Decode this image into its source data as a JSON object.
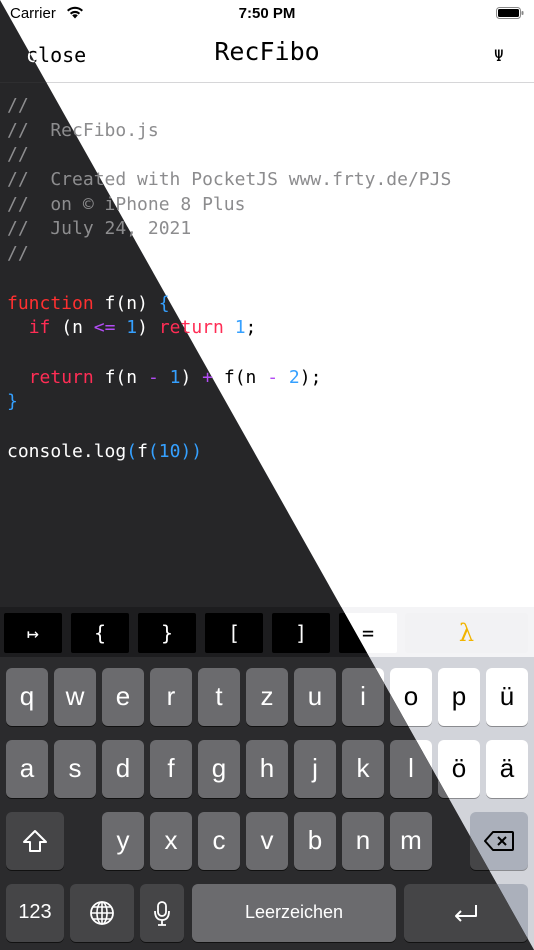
{
  "status": {
    "carrier": "Carrier",
    "time": "7:50 PM"
  },
  "nav": {
    "close_label": "close",
    "title": "RecFibo",
    "menu_symbol": "Ψ"
  },
  "code": {
    "c1": "//",
    "c2": "//  RecFibo.js",
    "c3": "//",
    "c4": "//  Created with PocketJS www.frty.de/PJS",
    "c5": "//  on © iPhone 8 Plus",
    "c6": "//  July 24, 2021",
    "c7": "//",
    "function_kw": "function",
    "fn_name": "f",
    "param": "n",
    "if_kw": "if",
    "lte": "<=",
    "one": "1",
    "two": "2",
    "return_kw": "return",
    "minus": "-",
    "plus": "+",
    "open_brace": "{",
    "close_brace": "}",
    "open_paren": "(",
    "close_paren": ")",
    "semicolon": ";",
    "console_log": "console.log",
    "ten": "10"
  },
  "accessory": {
    "keys": [
      "↦",
      "{",
      "}",
      "[",
      "]",
      "="
    ],
    "lambda": "λ"
  },
  "keyboard": {
    "row1": [
      "q",
      "w",
      "e",
      "r",
      "t",
      "z",
      "u",
      "i",
      "o",
      "p",
      "ü"
    ],
    "row2": [
      "a",
      "s",
      "d",
      "f",
      "g",
      "h",
      "j",
      "k",
      "l",
      "ö",
      "ä"
    ],
    "row3": [
      "y",
      "x",
      "c",
      "v",
      "b",
      "n",
      "m"
    ],
    "numbers_label": "123",
    "space_label": "Leerzeichen"
  },
  "colors": {
    "keyword": "#ff3030",
    "return_keyword": "#ff2d55",
    "number": "#35a0ff",
    "operator": "#b34cf5",
    "comment": "#8d8d8f",
    "lambda_accent": "#f1b400"
  }
}
